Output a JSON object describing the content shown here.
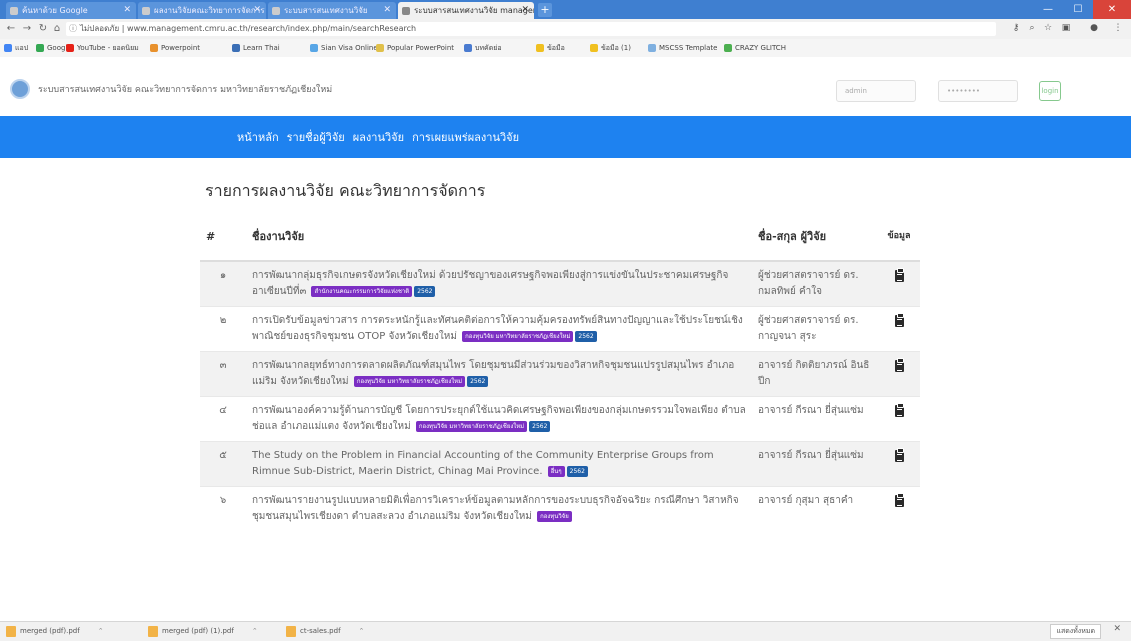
{
  "browser": {
    "tabs": [
      {
        "label": "ค้นหาด้วย Google",
        "active": false
      },
      {
        "label": "ผลงานวิจัยคณะวิทยาการจัดการ",
        "active": false
      },
      {
        "label": "ระบบสารสนเทศงานวิจัย",
        "active": false
      },
      {
        "label": "ระบบสารสนเทศงานวิจัย management",
        "active": true
      }
    ],
    "new_tab": "+",
    "url_security": "ไม่ปลอดภัย",
    "url": "www.management.cmru.ac.th/research/index.php/main/searchResearch",
    "bookmarks": [
      {
        "label": "แอป",
        "color": "#4285f4"
      },
      {
        "label": "Google",
        "color": "#34a853"
      },
      {
        "label": "YouTube - ยอดนิยม",
        "color": "#e62117"
      },
      {
        "label": "Powerpoint",
        "color": "#e8912d"
      },
      {
        "label": "Learn Thai",
        "color": "#3b6fb6"
      },
      {
        "label": "Sian Visa Online",
        "color": "#58a6e6"
      },
      {
        "label": "Popular PowerPoint",
        "color": "#e0c04a"
      },
      {
        "label": "บทคัดย่อ",
        "color": "#4a7bd0"
      },
      {
        "label": "ข้อมือ",
        "color": "#f0c020"
      },
      {
        "label": "ข้อมือ (1)",
        "color": "#f0c020"
      },
      {
        "label": "MSCSS Template",
        "color": "#7fb0e0"
      },
      {
        "label": "CRAZY GLITCH",
        "color": "#4caf50"
      }
    ]
  },
  "site": {
    "title": "ระบบสารสนเทศงานวิจัย คณะวิทยาการจัดการ มหาวิทยาลัยราชภัฏเชียงใหม่",
    "username_placeholder": "admin",
    "password_placeholder": "••••••••",
    "login_label": "login",
    "nav": [
      "หน้าหลัก",
      "รายชื่อผู้วิจัย",
      "ผลงานวิจัย",
      "การเผยแพร่ผลงานวิจัย"
    ]
  },
  "main": {
    "heading": "รายการผลงานวิจัย คณะวิทยาการจัดการ",
    "columns": {
      "num": "#",
      "title": "ชื่องานวิจัย",
      "author": "ชื่อ-สกุล ผู้วิจัย",
      "info": "ข้อมูล"
    },
    "rows": [
      {
        "num": "๑",
        "title": "การพัฒนากลุ่มธุรกิจเกษตรจังหวัดเชียงใหม่ ด้วยปรัชญาของเศรษฐกิจพอเพียงสู่การแข่งขันในประชาคมเศรษฐกิจอาเซียนปีที่๓",
        "badge1": "สำนักงานคณะกรรมการวิจัยแห่งชาติ",
        "badge2": "2562",
        "author": "ผู้ช่วยศาสตราจารย์ ดร. กมลทิพย์ คำใจ"
      },
      {
        "num": "๒",
        "title": "การเปิดรับข้อมูลข่าวสาร การตระหนักรู้และทัศนคติต่อการให้ความคุ้มครองทรัพย์สินทางปัญญาและใช้ประโยชน์เชิงพาณิชย์ของธุรกิจชุมชน OTOP จังหวัดเชียงใหม่",
        "badge1": "กองทุนวิจัย มหาวิทยาลัยราชภัฏเชียงใหม่",
        "badge2": "2562",
        "author": "ผู้ช่วยศาสตราจารย์ ดร. กาญจนา สุระ"
      },
      {
        "num": "๓",
        "title": "การพัฒนากลยุทธ์ทางการตลาดผลิตภัณฑ์สมุนไพร โดยชุมชนมีส่วนร่วมของวิสาหกิจชุมชนแปรรูปสมุนไพร อำเภอแม่ริม จังหวัดเชียงใหม่",
        "badge1": "กองทุนวิจัย มหาวิทยาลัยราชภัฏเชียงใหม่",
        "badge2": "2562",
        "author": "อาจารย์ กิตติยาภรณ์ อินธิปีก"
      },
      {
        "num": "๔",
        "title": "การพัฒนาองค์ความรู้ด้านการบัญชี โดยการประยุกต์ใช้แนวคิดเศรษฐกิจพอเพียงของกลุ่มเกษตรรวมใจพอเพียง ตำบลช่อแล อำเภอแม่แตง จังหวัดเชียงใหม่",
        "badge1": "กองทุนวิจัย มหาวิทยาลัยราชภัฏเชียงใหม่",
        "badge2": "2562",
        "author": "อาจารย์ กีรณา ยี่สุ่นแซ่ม"
      },
      {
        "num": "๕",
        "title": "The Study on the Problem in Financial Accounting of the Community Enterprise Groups from Rimnue Sub-District, Maerin District, Chinag Mai Province.",
        "badge1": "อื่นๆ",
        "badge2": "2562",
        "author": "อาจารย์ กีรณา ยี่สุ่นแซ่ม"
      },
      {
        "num": "๖",
        "title": "การพัฒนารายงานรูปแบบหลายมิติเพื่อการวิเคราะห์ข้อมูลตามหลักการของระบบธุรกิจอัจฉริยะ กรณีศึกษา วิสาหกิจชุมชนสมุนไพรเชียงดา ตำบลสะลวง อำเภอแม่ริม จังหวัดเชียงใหม่",
        "badge1": "กองทุนวิจัย",
        "badge2": "",
        "author": "อาจารย์ กุสุมา สุธาคำ"
      }
    ]
  },
  "downloads": [
    {
      "label": "merged (pdf).pdf"
    },
    {
      "label": "merged (pdf) (1).pdf"
    },
    {
      "label": "ct-sales.pdf"
    }
  ],
  "downloads_show_all": "แสดงทั้งหมด"
}
